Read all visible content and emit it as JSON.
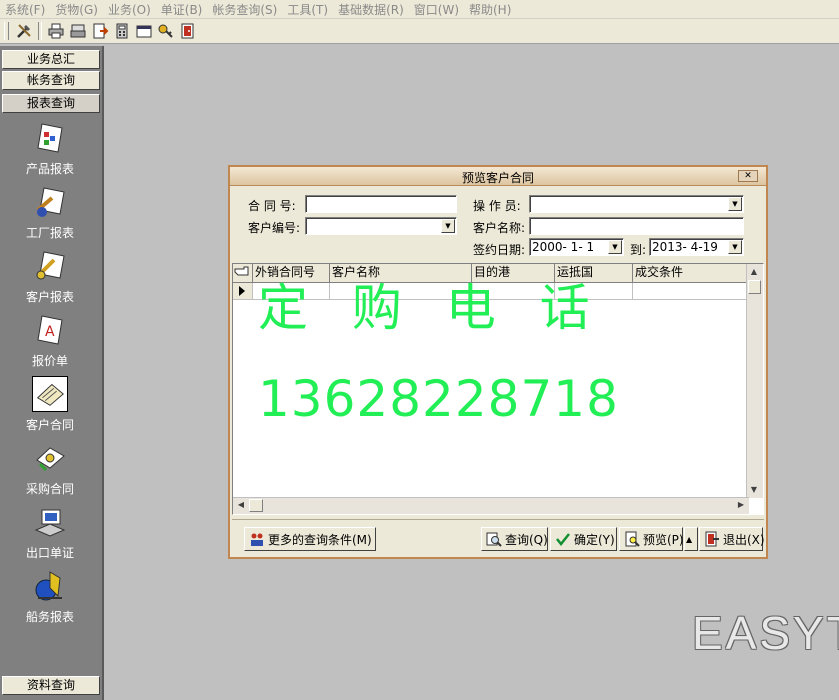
{
  "menu": [
    "系统(F)",
    "货物(G)",
    "业务(O)",
    "单证(B)",
    "帐务查询(S)",
    "工具(T)",
    "基础数据(R)",
    "窗口(W)",
    "帮助(H)"
  ],
  "sidebar": {
    "top_buttons": [
      "业务总汇",
      "帐务查询",
      "报表查询"
    ],
    "items": [
      {
        "label": "产品报表",
        "icon": "product-report-icon"
      },
      {
        "label": "工厂报表",
        "icon": "factory-report-icon"
      },
      {
        "label": "客户报表",
        "icon": "customer-report-icon"
      },
      {
        "label": "报价单",
        "icon": "quotation-icon"
      },
      {
        "label": "客户合同",
        "icon": "customer-contract-icon"
      },
      {
        "label": "采购合同",
        "icon": "purchase-contract-icon"
      },
      {
        "label": "出口单证",
        "icon": "export-document-icon"
      },
      {
        "label": "船务报表",
        "icon": "shipping-report-icon"
      }
    ],
    "bottom_button": "资料查询"
  },
  "dialog": {
    "title": "预览客户合同",
    "contract_no_label": "合 同 号:",
    "contract_no_value": "",
    "operator_label": "操 作 员:",
    "operator_value": "",
    "customer_code_label": "客户编号:",
    "customer_code_value": "",
    "customer_name_label": "客户名称:",
    "customer_name_value": "",
    "sign_date_label": "签约日期:",
    "date_from": "2000- 1- 1",
    "to_label": "到:",
    "date_to": "2013- 4-19",
    "columns": [
      "外销合同号",
      "客户名称",
      "目的港",
      "运抵国",
      "成交条件"
    ],
    "buttons": {
      "more": "更多的查询条件(M)",
      "query": "查询(Q)",
      "ok": "确定(Y)",
      "preview": "预览(P)",
      "exit": "退出(X)"
    }
  },
  "watermark": {
    "line1": "定 购 电 话",
    "line2": "13628228718",
    "color": "#22ee55"
  },
  "brand": "EASYT"
}
